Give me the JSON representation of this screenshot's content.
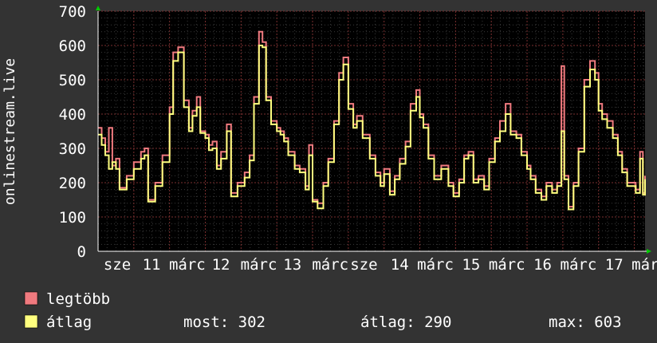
{
  "chart_data": {
    "type": "line",
    "ylabel": "onlinestream.live",
    "ylim": [
      0,
      700
    ],
    "yticks": [
      0,
      100,
      200,
      300,
      400,
      500,
      600,
      700
    ],
    "xlim": [
      0,
      7.65
    ],
    "xticks": [
      {
        "x": 0.0,
        "label": "sze"
      },
      {
        "x": 0.48,
        "label": "11"
      },
      {
        "x": 0.98,
        "label": "márc"
      },
      {
        "x": 1.45,
        "label": "12"
      },
      {
        "x": 1.98,
        "label": "márc"
      },
      {
        "x": 2.45,
        "label": "13"
      },
      {
        "x": 2.98,
        "label": "márc"
      },
      {
        "x": 3.45,
        "label": "sze"
      },
      {
        "x": 3.95,
        "label": "14"
      },
      {
        "x": 4.45,
        "label": "márc"
      },
      {
        "x": 4.95,
        "label": "15"
      },
      {
        "x": 5.45,
        "label": "márc"
      },
      {
        "x": 5.95,
        "label": "16"
      },
      {
        "x": 6.45,
        "label": "márc"
      },
      {
        "x": 6.95,
        "label": "17"
      },
      {
        "x": 7.45,
        "label": "márc"
      },
      {
        "x": 7.62,
        "label": "m"
      }
    ],
    "grid": true,
    "series": [
      {
        "name": "legtöbb",
        "color": "#f07a7f",
        "points": [
          [
            0.0,
            360
          ],
          [
            0.05,
            330
          ],
          [
            0.1,
            290
          ],
          [
            0.15,
            360
          ],
          [
            0.2,
            250
          ],
          [
            0.25,
            270
          ],
          [
            0.3,
            185
          ],
          [
            0.4,
            220
          ],
          [
            0.5,
            260
          ],
          [
            0.6,
            290
          ],
          [
            0.65,
            300
          ],
          [
            0.7,
            150
          ],
          [
            0.8,
            200
          ],
          [
            0.9,
            280
          ],
          [
            1.0,
            420
          ],
          [
            1.05,
            580
          ],
          [
            1.12,
            595
          ],
          [
            1.2,
            440
          ],
          [
            1.27,
            360
          ],
          [
            1.32,
            410
          ],
          [
            1.38,
            450
          ],
          [
            1.43,
            350
          ],
          [
            1.5,
            340
          ],
          [
            1.55,
            310
          ],
          [
            1.6,
            320
          ],
          [
            1.66,
            250
          ],
          [
            1.72,
            290
          ],
          [
            1.8,
            370
          ],
          [
            1.86,
            170
          ],
          [
            1.95,
            200
          ],
          [
            2.05,
            230
          ],
          [
            2.12,
            280
          ],
          [
            2.18,
            450
          ],
          [
            2.25,
            640
          ],
          [
            2.3,
            610
          ],
          [
            2.35,
            450
          ],
          [
            2.42,
            380
          ],
          [
            2.5,
            360
          ],
          [
            2.55,
            350
          ],
          [
            2.6,
            330
          ],
          [
            2.66,
            290
          ],
          [
            2.75,
            250
          ],
          [
            2.82,
            240
          ],
          [
            2.9,
            190
          ],
          [
            2.95,
            310
          ],
          [
            3.0,
            150
          ],
          [
            3.07,
            140
          ],
          [
            3.15,
            200
          ],
          [
            3.22,
            270
          ],
          [
            3.3,
            380
          ],
          [
            3.37,
            520
          ],
          [
            3.43,
            565
          ],
          [
            3.5,
            430
          ],
          [
            3.57,
            370
          ],
          [
            3.62,
            395
          ],
          [
            3.7,
            340
          ],
          [
            3.8,
            280
          ],
          [
            3.88,
            230
          ],
          [
            3.95,
            200
          ],
          [
            4.0,
            240
          ],
          [
            4.08,
            175
          ],
          [
            4.15,
            220
          ],
          [
            4.22,
            270
          ],
          [
            4.3,
            320
          ],
          [
            4.37,
            430
          ],
          [
            4.45,
            470
          ],
          [
            4.5,
            400
          ],
          [
            4.55,
            370
          ],
          [
            4.62,
            280
          ],
          [
            4.7,
            220
          ],
          [
            4.8,
            250
          ],
          [
            4.9,
            200
          ],
          [
            4.97,
            170
          ],
          [
            5.05,
            210
          ],
          [
            5.12,
            280
          ],
          [
            5.18,
            290
          ],
          [
            5.25,
            210
          ],
          [
            5.32,
            220
          ],
          [
            5.4,
            190
          ],
          [
            5.47,
            270
          ],
          [
            5.55,
            330
          ],
          [
            5.62,
            380
          ],
          [
            5.7,
            430
          ],
          [
            5.77,
            350
          ],
          [
            5.85,
            340
          ],
          [
            5.92,
            290
          ],
          [
            6.0,
            250
          ],
          [
            6.05,
            220
          ],
          [
            6.12,
            180
          ],
          [
            6.2,
            160
          ],
          [
            6.27,
            200
          ],
          [
            6.35,
            180
          ],
          [
            6.42,
            200
          ],
          [
            6.48,
            540
          ],
          [
            6.52,
            220
          ],
          [
            6.58,
            130
          ],
          [
            6.65,
            200
          ],
          [
            6.72,
            300
          ],
          [
            6.8,
            500
          ],
          [
            6.88,
            555
          ],
          [
            6.95,
            520
          ],
          [
            7.0,
            430
          ],
          [
            7.05,
            400
          ],
          [
            7.12,
            380
          ],
          [
            7.2,
            340
          ],
          [
            7.27,
            290
          ],
          [
            7.33,
            240
          ],
          [
            7.4,
            200
          ],
          [
            7.47,
            200
          ],
          [
            7.52,
            180
          ],
          [
            7.58,
            290
          ],
          [
            7.62,
            170
          ],
          [
            7.65,
            220
          ]
        ]
      },
      {
        "name": "átlag",
        "color": "#ffff7f",
        "points": [
          [
            0.0,
            340
          ],
          [
            0.05,
            310
          ],
          [
            0.1,
            280
          ],
          [
            0.15,
            240
          ],
          [
            0.2,
            260
          ],
          [
            0.25,
            240
          ],
          [
            0.3,
            180
          ],
          [
            0.4,
            210
          ],
          [
            0.5,
            240
          ],
          [
            0.6,
            270
          ],
          [
            0.65,
            280
          ],
          [
            0.7,
            145
          ],
          [
            0.8,
            190
          ],
          [
            0.9,
            260
          ],
          [
            1.0,
            400
          ],
          [
            1.05,
            555
          ],
          [
            1.12,
            580
          ],
          [
            1.2,
            420
          ],
          [
            1.27,
            350
          ],
          [
            1.32,
            395
          ],
          [
            1.38,
            420
          ],
          [
            1.43,
            345
          ],
          [
            1.5,
            330
          ],
          [
            1.55,
            295
          ],
          [
            1.6,
            300
          ],
          [
            1.66,
            240
          ],
          [
            1.72,
            270
          ],
          [
            1.8,
            350
          ],
          [
            1.86,
            160
          ],
          [
            1.95,
            190
          ],
          [
            2.05,
            215
          ],
          [
            2.12,
            265
          ],
          [
            2.18,
            430
          ],
          [
            2.25,
            600
          ],
          [
            2.3,
            595
          ],
          [
            2.35,
            440
          ],
          [
            2.42,
            370
          ],
          [
            2.5,
            350
          ],
          [
            2.55,
            340
          ],
          [
            2.6,
            320
          ],
          [
            2.66,
            280
          ],
          [
            2.75,
            240
          ],
          [
            2.82,
            230
          ],
          [
            2.9,
            180
          ],
          [
            2.95,
            280
          ],
          [
            3.0,
            145
          ],
          [
            3.07,
            125
          ],
          [
            3.15,
            190
          ],
          [
            3.22,
            260
          ],
          [
            3.3,
            370
          ],
          [
            3.37,
            500
          ],
          [
            3.43,
            545
          ],
          [
            3.5,
            415
          ],
          [
            3.57,
            360
          ],
          [
            3.62,
            380
          ],
          [
            3.7,
            330
          ],
          [
            3.8,
            270
          ],
          [
            3.88,
            220
          ],
          [
            3.95,
            190
          ],
          [
            4.0,
            225
          ],
          [
            4.08,
            165
          ],
          [
            4.15,
            210
          ],
          [
            4.22,
            255
          ],
          [
            4.3,
            305
          ],
          [
            4.37,
            410
          ],
          [
            4.45,
            450
          ],
          [
            4.5,
            390
          ],
          [
            4.55,
            360
          ],
          [
            4.62,
            270
          ],
          [
            4.7,
            210
          ],
          [
            4.8,
            240
          ],
          [
            4.9,
            190
          ],
          [
            4.97,
            160
          ],
          [
            5.05,
            200
          ],
          [
            5.12,
            270
          ],
          [
            5.18,
            280
          ],
          [
            5.25,
            200
          ],
          [
            5.32,
            210
          ],
          [
            5.4,
            180
          ],
          [
            5.47,
            260
          ],
          [
            5.55,
            320
          ],
          [
            5.62,
            350
          ],
          [
            5.7,
            400
          ],
          [
            5.77,
            340
          ],
          [
            5.85,
            330
          ],
          [
            5.92,
            280
          ],
          [
            6.0,
            240
          ],
          [
            6.05,
            210
          ],
          [
            6.12,
            170
          ],
          [
            6.2,
            150
          ],
          [
            6.27,
            190
          ],
          [
            6.35,
            170
          ],
          [
            6.42,
            190
          ],
          [
            6.48,
            350
          ],
          [
            6.52,
            210
          ],
          [
            6.58,
            122
          ],
          [
            6.65,
            190
          ],
          [
            6.72,
            290
          ],
          [
            6.8,
            480
          ],
          [
            6.88,
            530
          ],
          [
            6.95,
            500
          ],
          [
            7.0,
            410
          ],
          [
            7.05,
            385
          ],
          [
            7.12,
            360
          ],
          [
            7.2,
            330
          ],
          [
            7.27,
            280
          ],
          [
            7.33,
            230
          ],
          [
            7.4,
            190
          ],
          [
            7.47,
            190
          ],
          [
            7.52,
            170
          ],
          [
            7.58,
            270
          ],
          [
            7.62,
            165
          ],
          [
            7.65,
            210
          ]
        ]
      }
    ]
  },
  "legend": {
    "items": [
      {
        "label": "legtöbb",
        "color": "#f07a7f"
      },
      {
        "label": "átlag",
        "color": "#ffff7f"
      }
    ],
    "stats": {
      "most": "most: 302",
      "atlag": "átlag: 290",
      "max": "max: 603"
    }
  }
}
